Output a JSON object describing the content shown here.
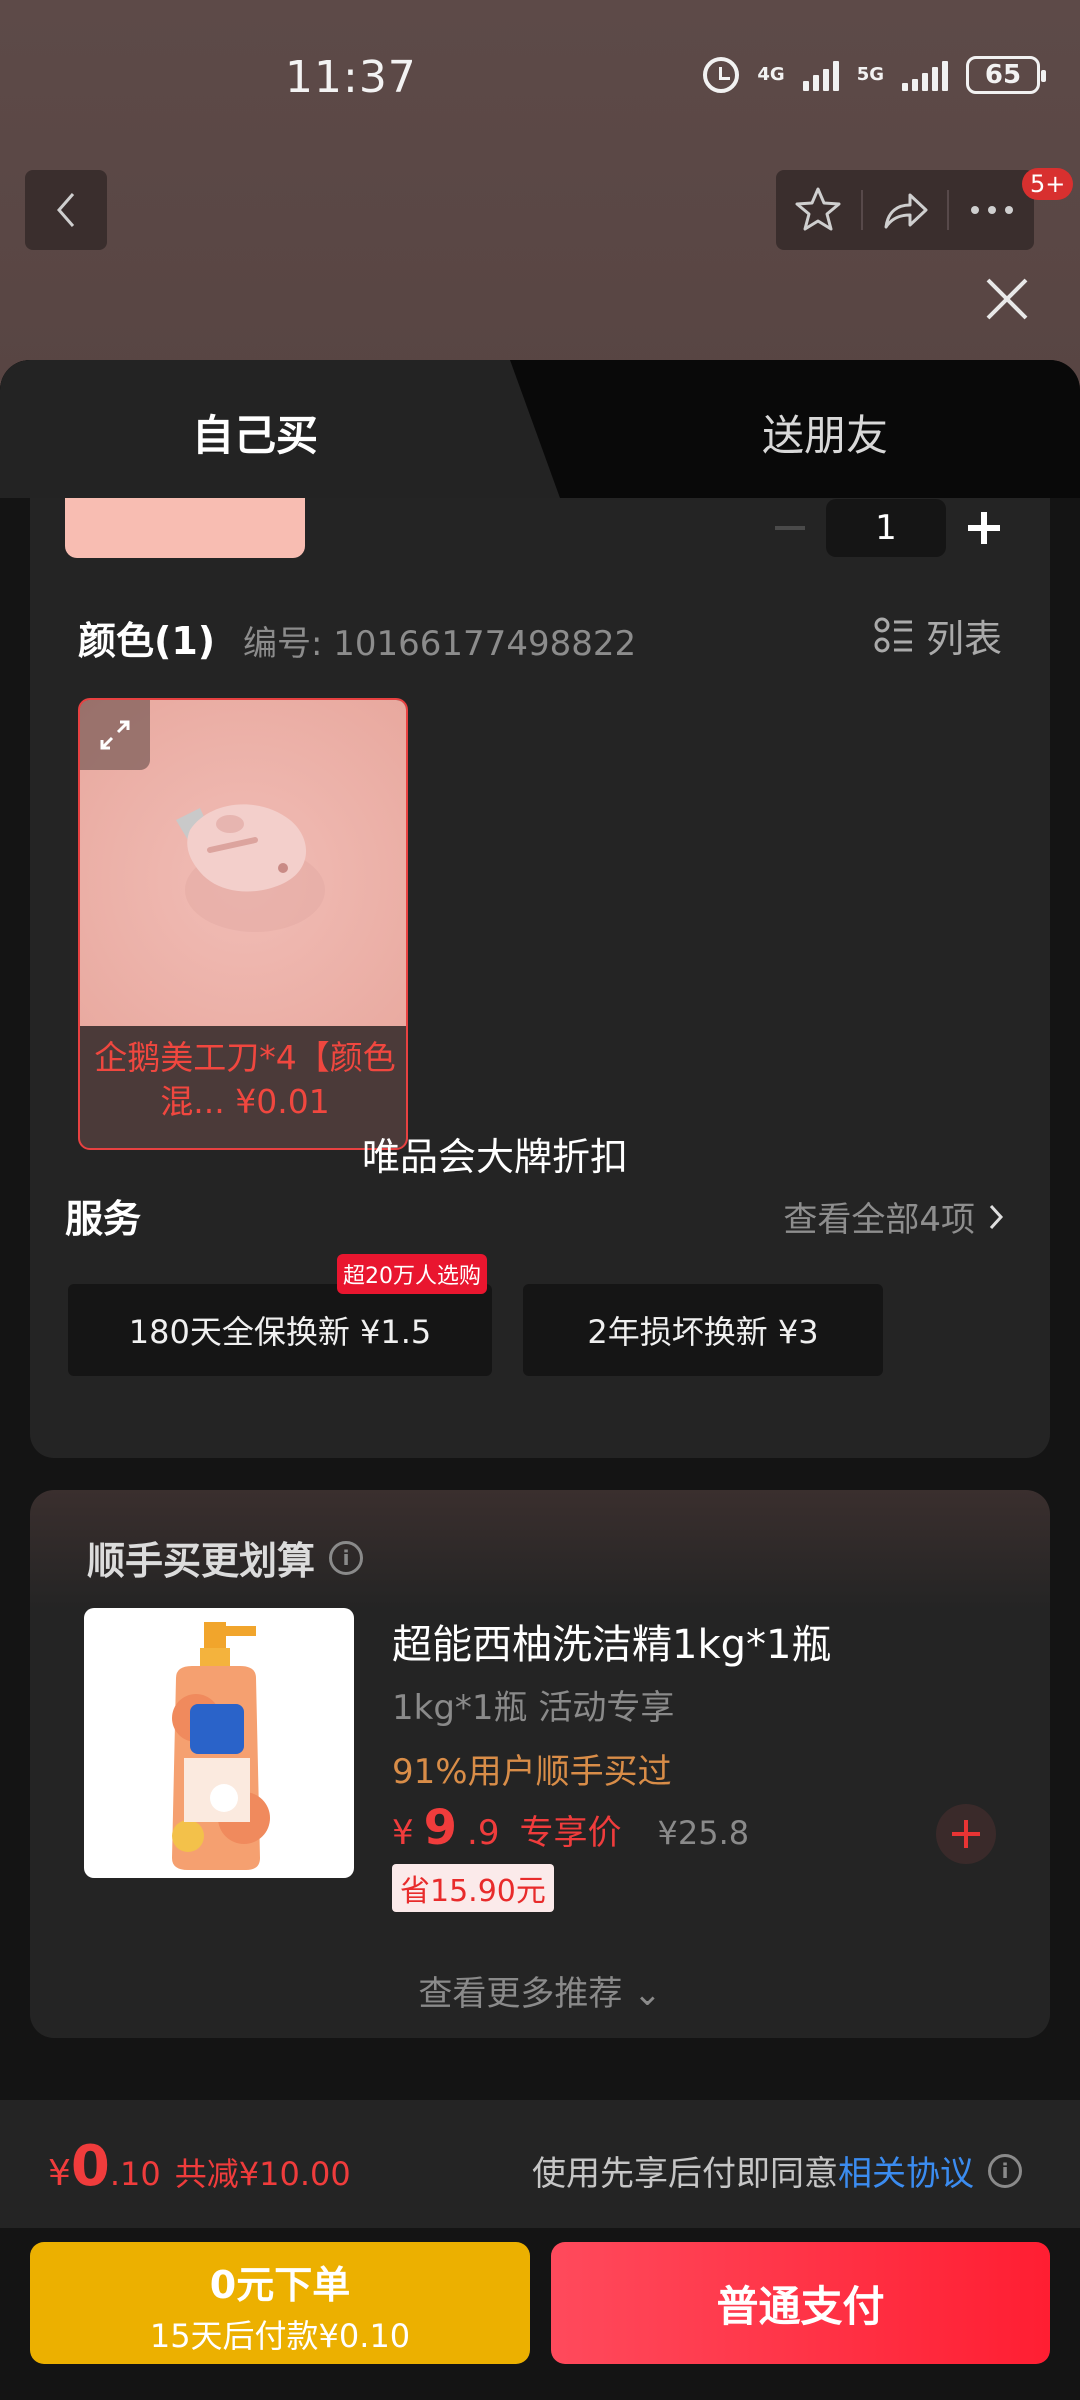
{
  "status_bar": {
    "time": "11:37",
    "network_1": "4G",
    "network_2": "5G",
    "battery": "65"
  },
  "header": {
    "badge": "5+"
  },
  "tabs": [
    {
      "label": "自己买",
      "active": true
    },
    {
      "label": "送朋友",
      "active": false
    }
  ],
  "quantity": "1",
  "color_section": {
    "title": "颜色(1)",
    "code": "编号: 10166177498822",
    "list_label": "列表"
  },
  "sku": {
    "label": "企鹅美工刀*4【颜色混... ¥0.01"
  },
  "watermark": "唯品会大牌折扣",
  "service": {
    "title": "服务",
    "view_all": "查看全部4项",
    "items": [
      {
        "label": "180天全保换新  ¥1.5",
        "badge": "超20万人选购"
      },
      {
        "label": "2年损坏换新  ¥3"
      }
    ]
  },
  "addon": {
    "title": "顺手买更划算",
    "product": {
      "name": "超能西柚洗洁精1kg*1瓶",
      "spec": "1kg*1瓶 活动专享",
      "buyers": "91%用户顺手买过",
      "price_symbol": "¥",
      "price_int": "9",
      "price_dec": ".9",
      "price_tag": "专享价",
      "original_price": "¥25.8",
      "save": "省15.90元"
    },
    "more": "查看更多推荐 ⌄"
  },
  "summary": {
    "symbol": "¥",
    "int": "0",
    "dec": ".10",
    "reduce": "共减¥10.00",
    "agree_text": "使用先享后付即同意",
    "agree_link": "相关协议"
  },
  "buttons": {
    "later_line1": "0元下单",
    "later_line2": "15天后付款¥0.10",
    "pay": "普通支付"
  },
  "colors": {
    "accent_red": "#f03c3c",
    "pay_red": "#ff1e32",
    "later_yellow": "#ecb000",
    "link_blue": "#3b8cf0"
  }
}
